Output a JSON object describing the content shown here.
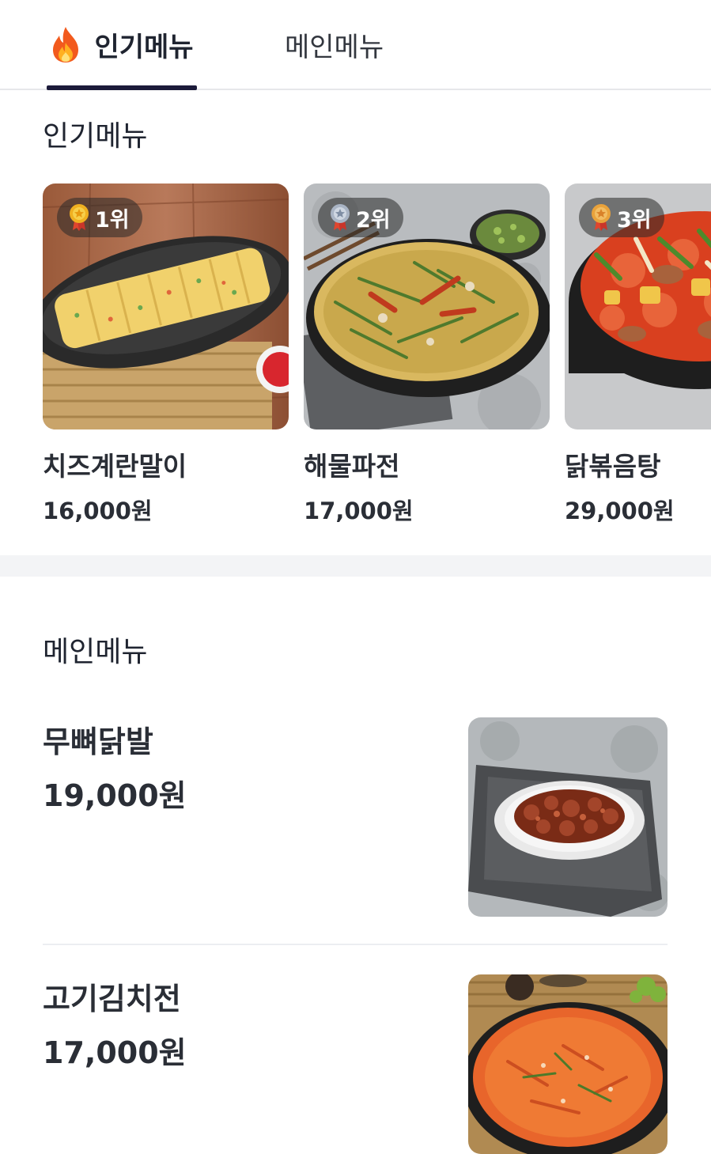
{
  "tabs": [
    {
      "label": "인기메뉴",
      "icon": "fire-icon",
      "active": true
    },
    {
      "label": "메인메뉴",
      "active": false
    }
  ],
  "sections": {
    "popular_title": "인기메뉴",
    "main_title": "메인메뉴"
  },
  "popular": [
    {
      "rank": "1위",
      "name": "치즈계란말이",
      "price": "16,000원",
      "medal": "gold-medal-icon",
      "image": "rolled-omelette"
    },
    {
      "rank": "2위",
      "name": "해물파전",
      "price": "17,000원",
      "medal": "silver-medal-icon",
      "image": "seafood-pancake"
    },
    {
      "rank": "3위",
      "name": "닭볶음탕",
      "price": "29,000원",
      "medal": "bronze-medal-icon",
      "image": "braised-chicken-stew"
    }
  ],
  "main_menu": [
    {
      "name": "무뼈닭발",
      "price": "19,000원",
      "image": "boneless-chicken-feet"
    },
    {
      "name": "고기김치전",
      "price": "17,000원",
      "image": "kimchi-pancake"
    }
  ],
  "colors": {
    "tab_underline": "#1c1b3a",
    "text": "#2a2e36",
    "divider_band": "#f3f4f6",
    "gold": "#f0b020",
    "silver": "#a9b4c4",
    "bronze": "#e9a23b"
  }
}
